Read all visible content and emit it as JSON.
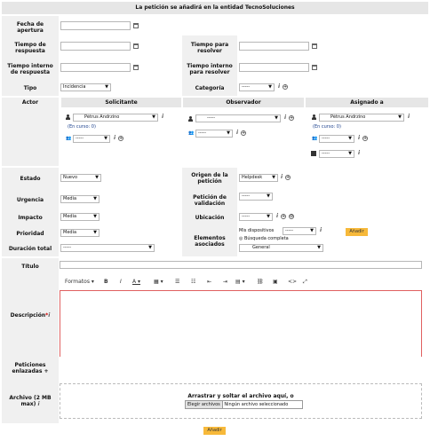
{
  "header": {
    "title": "La petición se añadirá en la entidad TecnoSoluciones"
  },
  "labels": {
    "fecha_apertura": "Fecha de apertura",
    "tiempo_respuesta": "Tiempo de respuesta",
    "tiempo_resolver": "Tiempo para resolver",
    "tiempo_interno_respuesta": "Tiempo interno de respuesta",
    "tiempo_interno_resolver": "Tiempo interno para resolver",
    "tipo": "Tipo",
    "categoria": "Categoría",
    "actor": "Actor",
    "estado": "Estado",
    "origen": "Origen de la petición",
    "urgencia": "Urgencia",
    "validacion": "Petición de validación",
    "impacto": "Impacto",
    "ubicacion": "Ubicación",
    "prioridad": "Prioridad",
    "elementos": "Elementos asociados",
    "duracion": "Duración total",
    "titulo": "Título",
    "descripcion": "Descripción",
    "peticiones_enlazadas": "Peticiones enlazadas",
    "archivo": "Archivo (2 MB max)"
  },
  "actor": {
    "solicitante": "Solicitante",
    "observador": "Observador",
    "asignado": "Asignado a",
    "solicitante_user": "Pétrus Andrzino",
    "asignado_user": "Pétrus Andrzino",
    "en_curso": "(En curso: 0)",
    "en_curso_asignado": "(En curso: 0)",
    "empty": "-----"
  },
  "fields": {
    "tipo": "Incidencia",
    "categoria": "-----",
    "estado": "Nuevo",
    "origen": "Helpdesk",
    "urgencia": "Media",
    "validacion": "-----",
    "impacto": "Media",
    "ubicacion": "-----",
    "prioridad": "Media",
    "duracion": "-----",
    "mis_dispositivos": "Mis dispositivos",
    "mis_dispositivos_value": "-----",
    "busqueda_completa": "Búsqueda completa",
    "general": "General",
    "anadir_elemento": "Añadir"
  },
  "editor": {
    "formatos": "Formatos"
  },
  "upload": {
    "drop_text": "Arrastrar y soltar el archivo aquí, o",
    "choose": "Elegir archivos",
    "none": "Ningún archivo seleccionado"
  },
  "submit": "Añadir",
  "colors": {
    "header_bg": "#e6e6e6",
    "label_bg": "#f0f0f0",
    "button": "#f7b93a",
    "editor_border": "#e06060"
  }
}
